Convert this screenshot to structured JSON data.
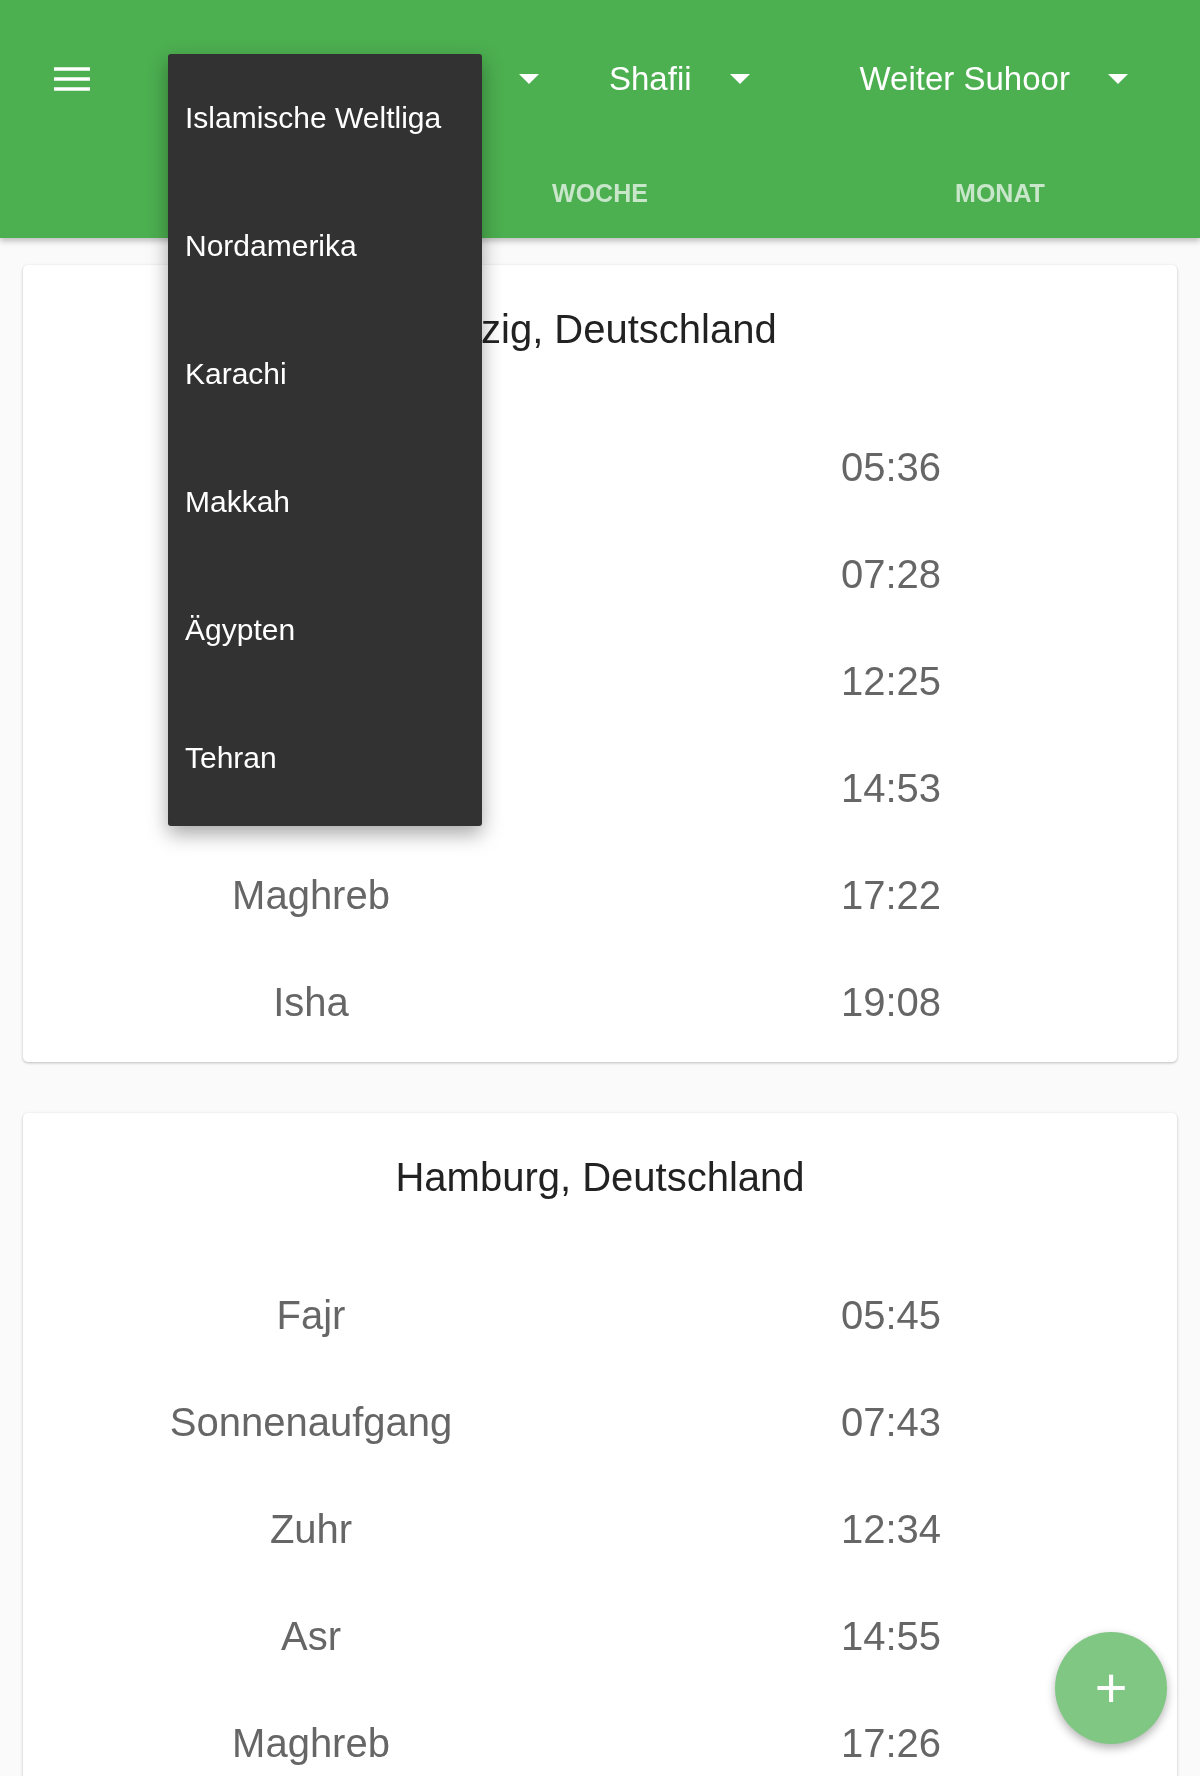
{
  "app_bar": {
    "dropdowns": [
      {
        "kind": "caret"
      },
      {
        "kind": "labeled",
        "label": "Shafii"
      },
      {
        "kind": "labeled",
        "label": "Weiter Suhoor"
      }
    ],
    "tabs": [
      {
        "label": "WOCHE",
        "selected": false
      },
      {
        "label": "MONAT",
        "selected": false
      }
    ]
  },
  "cards": [
    {
      "city": "zig, Deutschland",
      "rows": [
        {
          "time": "05:36"
        },
        {
          "time": "07:28"
        },
        {
          "time": "12:25"
        },
        {
          "time": "14:53"
        },
        {
          "label": "Maghreb",
          "time": "17:22"
        },
        {
          "label": "Isha",
          "time": "19:08"
        }
      ]
    },
    {
      "city": "Hamburg, Deutschland",
      "rows": [
        {
          "label": "Fajr",
          "time": "05:45"
        },
        {
          "label": "Sonnenaufgang",
          "time": "07:43"
        },
        {
          "label": "Zuhr",
          "time": "12:34"
        },
        {
          "label": "Asr",
          "time": "14:55"
        },
        {
          "label": "Maghreb",
          "time": "17:26"
        }
      ]
    }
  ],
  "menu": {
    "items": [
      "Islamische Weltliga",
      "Nordamerika",
      "Karachi",
      "Makkah",
      "Ägypten",
      "Tehran"
    ]
  },
  "fab": {
    "label": "+"
  }
}
